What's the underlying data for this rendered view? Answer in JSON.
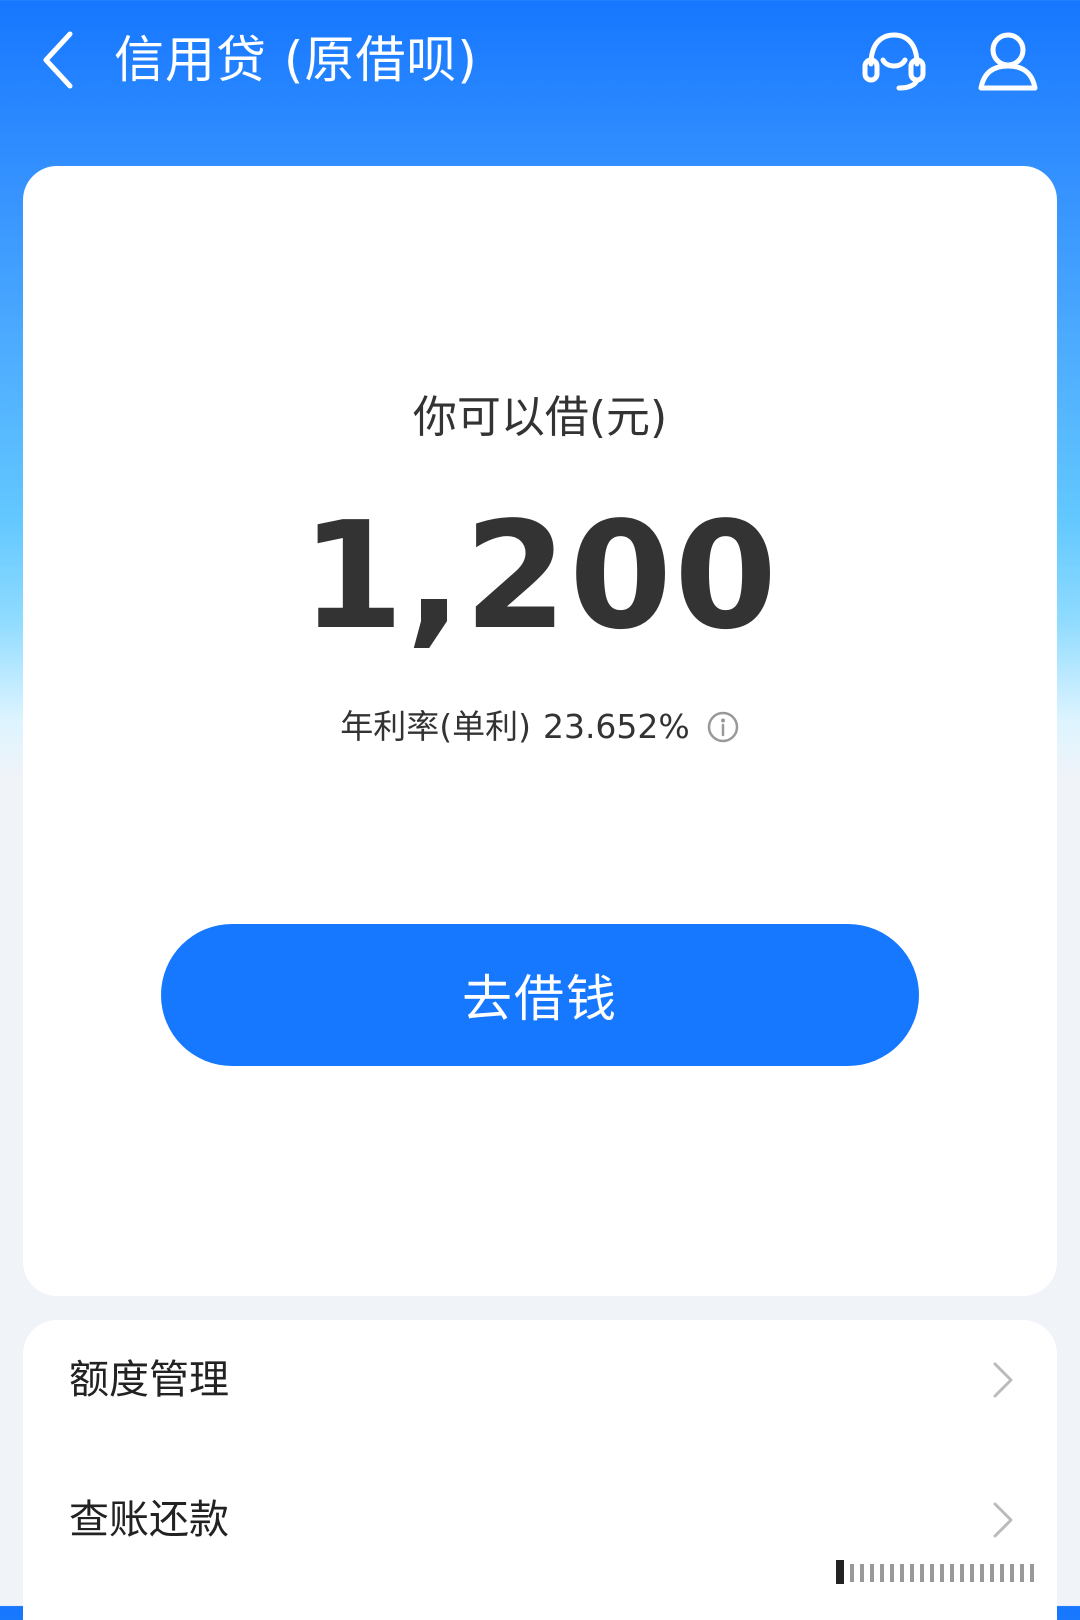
{
  "header": {
    "title": "信用贷 (原借呗)",
    "back_icon": "chevron-left-icon",
    "service_icon": "headset-icon",
    "profile_icon": "user-icon"
  },
  "main": {
    "available_label": "你可以借(元)",
    "amount": "1,200",
    "rate_label": "年利率(单利)",
    "rate_value": "23.652%",
    "info_icon": "info-icon",
    "borrow_button": "去借钱"
  },
  "menu": {
    "items": [
      {
        "label": "额度管理",
        "icon": "chevron-right-icon"
      },
      {
        "label": "查账还款",
        "icon": "chevron-right-icon"
      }
    ]
  },
  "colors": {
    "primary": "#1677FF",
    "text": "#333333",
    "background": "#F0F3F8"
  }
}
